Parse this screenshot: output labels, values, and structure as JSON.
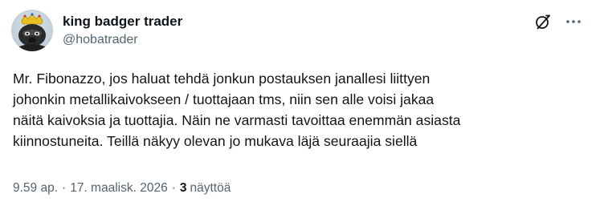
{
  "author": {
    "display_name": "king badger trader",
    "handle": "@hobatrader"
  },
  "post": {
    "text": "Mr. Fibonazzo, jos haluat tehdä jonkun postauksen janallesi liittyen\njohonkin metallikaivokseen / tuottajaan tms, niin sen alle voisi jakaa\nnäitä kaivoksia ja tuottajia. Näin ne varmasti tavoittaa enemmän asiasta\nkiinnostuneita. Teillä näkyy olevan jo mukava läjä seuraajia siellä"
  },
  "meta": {
    "time": "9.59 ap.",
    "separator": "·",
    "date": "17. maalisk. 2026",
    "views_count": "3",
    "views_label": "näyttöä"
  },
  "icons": {
    "grok": "grok-icon",
    "more": "more-options-icon"
  },
  "colors": {
    "text_primary": "#0f1419",
    "text_secondary": "#536471",
    "background": "#ffffff"
  }
}
